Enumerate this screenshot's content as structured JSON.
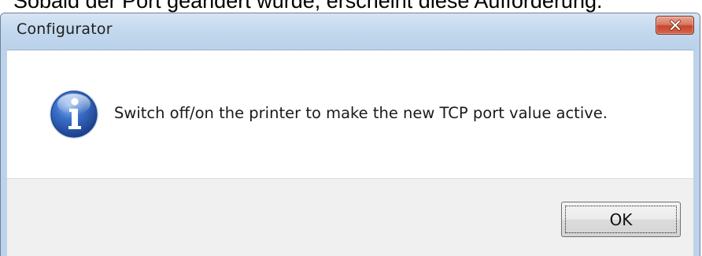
{
  "caption": {
    "text": "Sobald der Port geändert wurde, erscheint diese Aufforderung."
  },
  "dialog": {
    "title": "Configurator",
    "message": "Switch off/on the printer to make the new TCP port value active.",
    "icon": "info-icon",
    "buttons": {
      "ok_label": "OK"
    },
    "close_icon": "close-icon"
  },
  "colors": {
    "titlebar": "#c4d9ee",
    "close_button": "#c7462d",
    "info_icon": "#2e5fb5",
    "button_strip": "#f0f0f0"
  }
}
